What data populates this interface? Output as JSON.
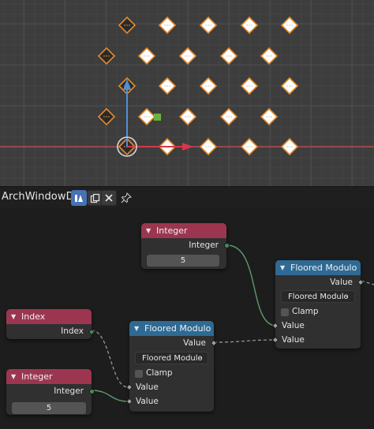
{
  "viewport": {
    "instances_note": "",
    "colors": {
      "background": "#3d3d3d",
      "grid": "#464646",
      "x_axis": "#b34a52",
      "instance_fill": "#ffffff",
      "instance_outline": "#e38a2c",
      "gizmo_y": "#4f8fd6",
      "gizmo_x": "#d3394a"
    }
  },
  "node_editor": {
    "tree_name": "ArchWindowDoor",
    "icons": {
      "fake_user": "node-tree-icon",
      "duplicate": "duplicate-icon",
      "unlink": "close-icon",
      "pin": "pin-icon"
    },
    "nodes": {
      "integer_top": {
        "title": "Integer",
        "output": "Integer",
        "value": "5"
      },
      "index": {
        "title": "Index",
        "output": "Index"
      },
      "integer_bottom": {
        "title": "Integer",
        "output": "Integer",
        "value": "5"
      },
      "mod_mid": {
        "title": "Floored Modulo",
        "output": "Value",
        "operation": "Floored Modulo",
        "clamp": "Clamp",
        "input_a": "Value",
        "input_b": "Value"
      },
      "mod_right": {
        "title": "Floored Modulo",
        "output": "Value",
        "operation": "Floored Modulo",
        "clamp": "Clamp",
        "input_a": "Value",
        "input_b": "Value"
      }
    }
  }
}
